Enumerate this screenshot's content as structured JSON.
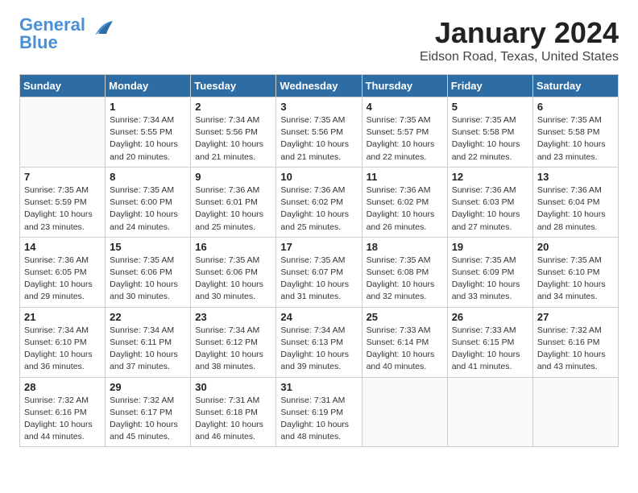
{
  "header": {
    "logo_line1": "General",
    "logo_line2": "Blue",
    "month_title": "January 2024",
    "location": "Eidson Road, Texas, United States"
  },
  "weekdays": [
    "Sunday",
    "Monday",
    "Tuesday",
    "Wednesday",
    "Thursday",
    "Friday",
    "Saturday"
  ],
  "weeks": [
    [
      {
        "day": "",
        "sunrise": "",
        "sunset": "",
        "daylight": ""
      },
      {
        "day": "1",
        "sunrise": "Sunrise: 7:34 AM",
        "sunset": "Sunset: 5:55 PM",
        "daylight": "Daylight: 10 hours and 20 minutes."
      },
      {
        "day": "2",
        "sunrise": "Sunrise: 7:34 AM",
        "sunset": "Sunset: 5:56 PM",
        "daylight": "Daylight: 10 hours and 21 minutes."
      },
      {
        "day": "3",
        "sunrise": "Sunrise: 7:35 AM",
        "sunset": "Sunset: 5:56 PM",
        "daylight": "Daylight: 10 hours and 21 minutes."
      },
      {
        "day": "4",
        "sunrise": "Sunrise: 7:35 AM",
        "sunset": "Sunset: 5:57 PM",
        "daylight": "Daylight: 10 hours and 22 minutes."
      },
      {
        "day": "5",
        "sunrise": "Sunrise: 7:35 AM",
        "sunset": "Sunset: 5:58 PM",
        "daylight": "Daylight: 10 hours and 22 minutes."
      },
      {
        "day": "6",
        "sunrise": "Sunrise: 7:35 AM",
        "sunset": "Sunset: 5:58 PM",
        "daylight": "Daylight: 10 hours and 23 minutes."
      }
    ],
    [
      {
        "day": "7",
        "sunrise": "Sunrise: 7:35 AM",
        "sunset": "Sunset: 5:59 PM",
        "daylight": "Daylight: 10 hours and 23 minutes."
      },
      {
        "day": "8",
        "sunrise": "Sunrise: 7:35 AM",
        "sunset": "Sunset: 6:00 PM",
        "daylight": "Daylight: 10 hours and 24 minutes."
      },
      {
        "day": "9",
        "sunrise": "Sunrise: 7:36 AM",
        "sunset": "Sunset: 6:01 PM",
        "daylight": "Daylight: 10 hours and 25 minutes."
      },
      {
        "day": "10",
        "sunrise": "Sunrise: 7:36 AM",
        "sunset": "Sunset: 6:02 PM",
        "daylight": "Daylight: 10 hours and 25 minutes."
      },
      {
        "day": "11",
        "sunrise": "Sunrise: 7:36 AM",
        "sunset": "Sunset: 6:02 PM",
        "daylight": "Daylight: 10 hours and 26 minutes."
      },
      {
        "day": "12",
        "sunrise": "Sunrise: 7:36 AM",
        "sunset": "Sunset: 6:03 PM",
        "daylight": "Daylight: 10 hours and 27 minutes."
      },
      {
        "day": "13",
        "sunrise": "Sunrise: 7:36 AM",
        "sunset": "Sunset: 6:04 PM",
        "daylight": "Daylight: 10 hours and 28 minutes."
      }
    ],
    [
      {
        "day": "14",
        "sunrise": "Sunrise: 7:36 AM",
        "sunset": "Sunset: 6:05 PM",
        "daylight": "Daylight: 10 hours and 29 minutes."
      },
      {
        "day": "15",
        "sunrise": "Sunrise: 7:35 AM",
        "sunset": "Sunset: 6:06 PM",
        "daylight": "Daylight: 10 hours and 30 minutes."
      },
      {
        "day": "16",
        "sunrise": "Sunrise: 7:35 AM",
        "sunset": "Sunset: 6:06 PM",
        "daylight": "Daylight: 10 hours and 30 minutes."
      },
      {
        "day": "17",
        "sunrise": "Sunrise: 7:35 AM",
        "sunset": "Sunset: 6:07 PM",
        "daylight": "Daylight: 10 hours and 31 minutes."
      },
      {
        "day": "18",
        "sunrise": "Sunrise: 7:35 AM",
        "sunset": "Sunset: 6:08 PM",
        "daylight": "Daylight: 10 hours and 32 minutes."
      },
      {
        "day": "19",
        "sunrise": "Sunrise: 7:35 AM",
        "sunset": "Sunset: 6:09 PM",
        "daylight": "Daylight: 10 hours and 33 minutes."
      },
      {
        "day": "20",
        "sunrise": "Sunrise: 7:35 AM",
        "sunset": "Sunset: 6:10 PM",
        "daylight": "Daylight: 10 hours and 34 minutes."
      }
    ],
    [
      {
        "day": "21",
        "sunrise": "Sunrise: 7:34 AM",
        "sunset": "Sunset: 6:10 PM",
        "daylight": "Daylight: 10 hours and 36 minutes."
      },
      {
        "day": "22",
        "sunrise": "Sunrise: 7:34 AM",
        "sunset": "Sunset: 6:11 PM",
        "daylight": "Daylight: 10 hours and 37 minutes."
      },
      {
        "day": "23",
        "sunrise": "Sunrise: 7:34 AM",
        "sunset": "Sunset: 6:12 PM",
        "daylight": "Daylight: 10 hours and 38 minutes."
      },
      {
        "day": "24",
        "sunrise": "Sunrise: 7:34 AM",
        "sunset": "Sunset: 6:13 PM",
        "daylight": "Daylight: 10 hours and 39 minutes."
      },
      {
        "day": "25",
        "sunrise": "Sunrise: 7:33 AM",
        "sunset": "Sunset: 6:14 PM",
        "daylight": "Daylight: 10 hours and 40 minutes."
      },
      {
        "day": "26",
        "sunrise": "Sunrise: 7:33 AM",
        "sunset": "Sunset: 6:15 PM",
        "daylight": "Daylight: 10 hours and 41 minutes."
      },
      {
        "day": "27",
        "sunrise": "Sunrise: 7:32 AM",
        "sunset": "Sunset: 6:16 PM",
        "daylight": "Daylight: 10 hours and 43 minutes."
      }
    ],
    [
      {
        "day": "28",
        "sunrise": "Sunrise: 7:32 AM",
        "sunset": "Sunset: 6:16 PM",
        "daylight": "Daylight: 10 hours and 44 minutes."
      },
      {
        "day": "29",
        "sunrise": "Sunrise: 7:32 AM",
        "sunset": "Sunset: 6:17 PM",
        "daylight": "Daylight: 10 hours and 45 minutes."
      },
      {
        "day": "30",
        "sunrise": "Sunrise: 7:31 AM",
        "sunset": "Sunset: 6:18 PM",
        "daylight": "Daylight: 10 hours and 46 minutes."
      },
      {
        "day": "31",
        "sunrise": "Sunrise: 7:31 AM",
        "sunset": "Sunset: 6:19 PM",
        "daylight": "Daylight: 10 hours and 48 minutes."
      },
      {
        "day": "",
        "sunrise": "",
        "sunset": "",
        "daylight": ""
      },
      {
        "day": "",
        "sunrise": "",
        "sunset": "",
        "daylight": ""
      },
      {
        "day": "",
        "sunrise": "",
        "sunset": "",
        "daylight": ""
      }
    ]
  ]
}
